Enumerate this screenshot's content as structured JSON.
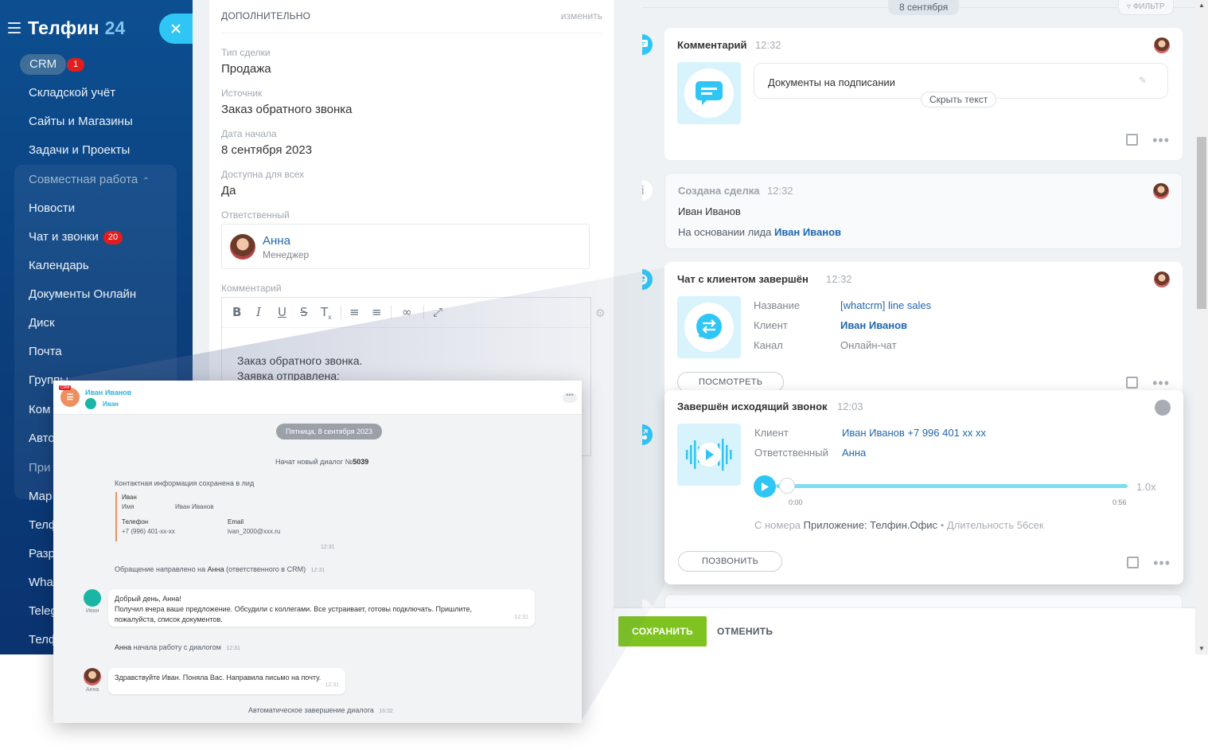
{
  "app": {
    "logo_text": "Телфин",
    "logo_number": "24"
  },
  "sidebar": {
    "crm_label": "CRM",
    "crm_badge": "1",
    "items": [
      {
        "label": "Складской учёт"
      },
      {
        "label": "Сайты и Магазины"
      },
      {
        "label": "Задачи и Проекты"
      }
    ],
    "group_title": "Совместная работа",
    "group_items": [
      {
        "label": "Новости"
      },
      {
        "label": "Чат и звонки",
        "badge": "20"
      },
      {
        "label": "Календарь"
      },
      {
        "label": "Документы Онлайн"
      },
      {
        "label": "Диск"
      },
      {
        "label": "Почта"
      },
      {
        "label": "Группы"
      },
      {
        "label": "Ком"
      },
      {
        "label": "Авто"
      }
    ],
    "lower_title": "При",
    "lower_items": [
      {
        "label": "Мар"
      },
      {
        "label": "Телф"
      },
      {
        "label": "Разр"
      },
      {
        "label": "Wha"
      },
      {
        "label": "Teleg"
      },
      {
        "label": "Телф"
      }
    ]
  },
  "form": {
    "section_title": "ДОПОЛНИТЕЛЬНО",
    "edit_link": "изменить",
    "fields": [
      {
        "label": "Тип сделки",
        "value": "Продажа"
      },
      {
        "label": "Источник",
        "value": "Заказ обратного звонка"
      },
      {
        "label": "Дата начала",
        "value": "8 сентября 2023"
      },
      {
        "label": "Доступна для всех",
        "value": "Да"
      }
    ],
    "responsible_label": "Ответственный",
    "responsible_name": "Анна",
    "responsible_role": "Менеджер",
    "comment_label": "Комментарий",
    "comment_line1": "Заказ обратного звонка.",
    "comment_line2": "Заявка отправлена:"
  },
  "timeline": {
    "date": "8 сентября",
    "filter": "ФИЛЬТР",
    "comment": {
      "title": "Комментарий",
      "time": "12:32",
      "text": "Документы на подписании",
      "hide_text": "Скрыть текст"
    },
    "created": {
      "title": "Создана сделка",
      "time": "12:32",
      "person": "Иван Иванов",
      "basis_prefix": "На основании лида",
      "basis_name": "Иван Иванов"
    },
    "chat_done": {
      "title": "Чат с клиентом завершён",
      "time": "12:32",
      "name_label": "Название",
      "name_value": "[whatcrm] line sales",
      "client_label": "Клиент",
      "client_value": "Иван Иванов",
      "channel_label": "Канал",
      "channel_value": "Онлайн-чат",
      "view_button": "ПОСМОТРЕТЬ"
    },
    "call": {
      "title": "Завершён исходящий звонок",
      "time": "12:03",
      "client_label": "Клиент",
      "client_value": "Иван Иванов +7 996 401 xx xx",
      "resp_label": "Ответственный",
      "resp_value": "Анна",
      "speed": "1.0x",
      "time_start": "0:00",
      "time_end": "0:56",
      "progress": 0,
      "meta_prefix": "С номера",
      "meta_app": "Приложение: Телфин.Офис",
      "meta_duration": "• Длительность 56сек",
      "call_button": "ПОЗВОНИТЬ"
    },
    "save_button": "СОХРАНИТЬ",
    "cancel_button": "ОТМЕНИТЬ"
  },
  "chat": {
    "crm_tag": "CRM",
    "contact_name": "Иван Иванов",
    "contact_sub": "Иван",
    "date": "Пятница, 8 сентября 2023",
    "dialog_started_prefix": "Начат новый диалог №",
    "dialog_number": "5039",
    "contact_saved": "Контактная информация сохранена в лид",
    "card_first": "Иван",
    "card_name_label": "Имя",
    "card_name_value": "Иван Иванов",
    "card_phone_label": "Телефон",
    "card_phone_value": "+7 (996) 401-xx-xx",
    "card_email_label": "Email",
    "card_email_value": "ivan_2000@xxx.ru",
    "card_time": "12:31",
    "routed_prefix": "Обращение направлено на",
    "routed_name": "Анна",
    "routed_suffix": "(ответственного в CRM)",
    "routed_time": "12:31",
    "msg1_line1": "Добрый день, Анна!",
    "msg1_line2": "Получил вчера ваше предложение. Обсудили с коллегами. Все устраивает, готовы подключать. Пришлите,",
    "msg1_line3": "пожалуйста, список документов.",
    "msg1_time": "12:31",
    "msg1_author": "Иван",
    "started_name": "Анна",
    "started_suffix": "начала работу с диалогом",
    "started_time": "12:31",
    "msg2_text": "Здравствуйте Иван. Поняла Вас. Направила письмо на почту.",
    "msg2_time": "12:31",
    "msg2_author": "Анна",
    "auto_close": "Автоматическое завершение диалога",
    "auto_close_time": "16:32"
  },
  "colors": {
    "accent": "#2fc6f6",
    "link": "#2067b0",
    "save_green": "#7ec320",
    "badge_red": "#e31d1d"
  }
}
